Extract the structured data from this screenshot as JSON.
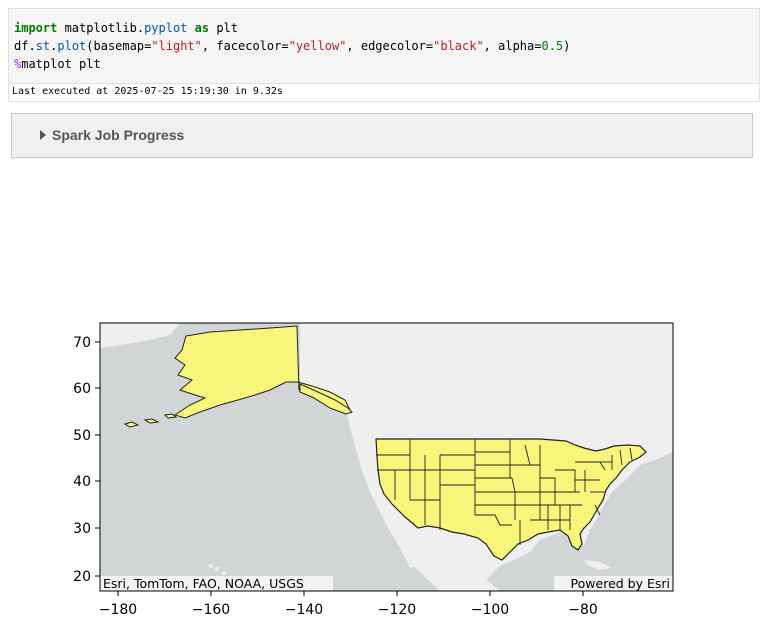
{
  "code": {
    "line1": {
      "kw1": "import",
      "mod": " matplotlib.",
      "attr": "pyplot",
      "sp": " ",
      "kw2": "as",
      "rest": " plt"
    },
    "line2": {
      "a": "df.",
      "b": "st",
      "c": ".",
      "d": "plot",
      "e": "(basemap=",
      "f": "\"light\"",
      "g": ", facecolor=",
      "h": "\"yellow\"",
      "i": ", edgecolor=",
      "j": "\"black\"",
      "k": ", alpha=",
      "l": "0.5",
      "m": ")"
    },
    "line3": {
      "pct": "%",
      "rest": "matplot plt"
    }
  },
  "exec_info": "Last executed at 2025-07-25 15:19:30 in 9.32s",
  "spark": {
    "label": "Spark Job Progress"
  },
  "map": {
    "basemap": "light",
    "facecolor": "yellow",
    "edgecolor": "black",
    "alpha": 0.5,
    "attribution_left": "Esri, TomTom, FAO, NOAA, USGS",
    "attribution_right": "Powered by Esri",
    "x_ticks": [
      "−180",
      "−160",
      "−140",
      "−120",
      "−100",
      "−80"
    ],
    "y_ticks": [
      "70",
      "60",
      "50",
      "40",
      "30",
      "20"
    ],
    "xlim": [
      -183,
      -65
    ],
    "ylim": [
      18,
      73
    ]
  },
  "colors": {
    "ocean": "#d2d5d6",
    "land": "#efefef",
    "fill": "#f7f57a"
  }
}
